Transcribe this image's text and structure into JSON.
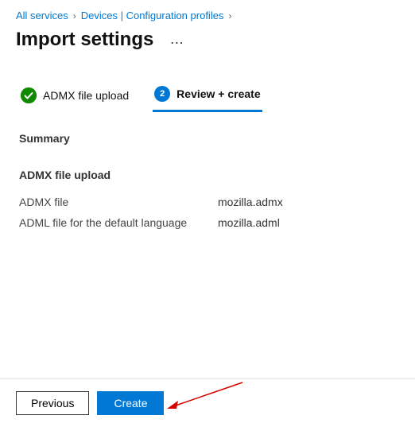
{
  "breadcrumb": {
    "items": [
      {
        "label": "All services"
      },
      {
        "label": "Devices | Configuration profiles"
      }
    ]
  },
  "page": {
    "title": "Import settings"
  },
  "tabs": {
    "items": [
      {
        "label": "ADMX file upload",
        "step": "1",
        "status": "done"
      },
      {
        "label": "Review + create",
        "step": "2",
        "status": "active"
      }
    ]
  },
  "summary": {
    "heading": "Summary",
    "section_heading": "ADMX file upload",
    "rows": [
      {
        "key": "ADMX file",
        "value": "mozilla.admx"
      },
      {
        "key": "ADML file for the default language",
        "value": "mozilla.adml"
      }
    ]
  },
  "footer": {
    "previous": "Previous",
    "create": "Create"
  }
}
